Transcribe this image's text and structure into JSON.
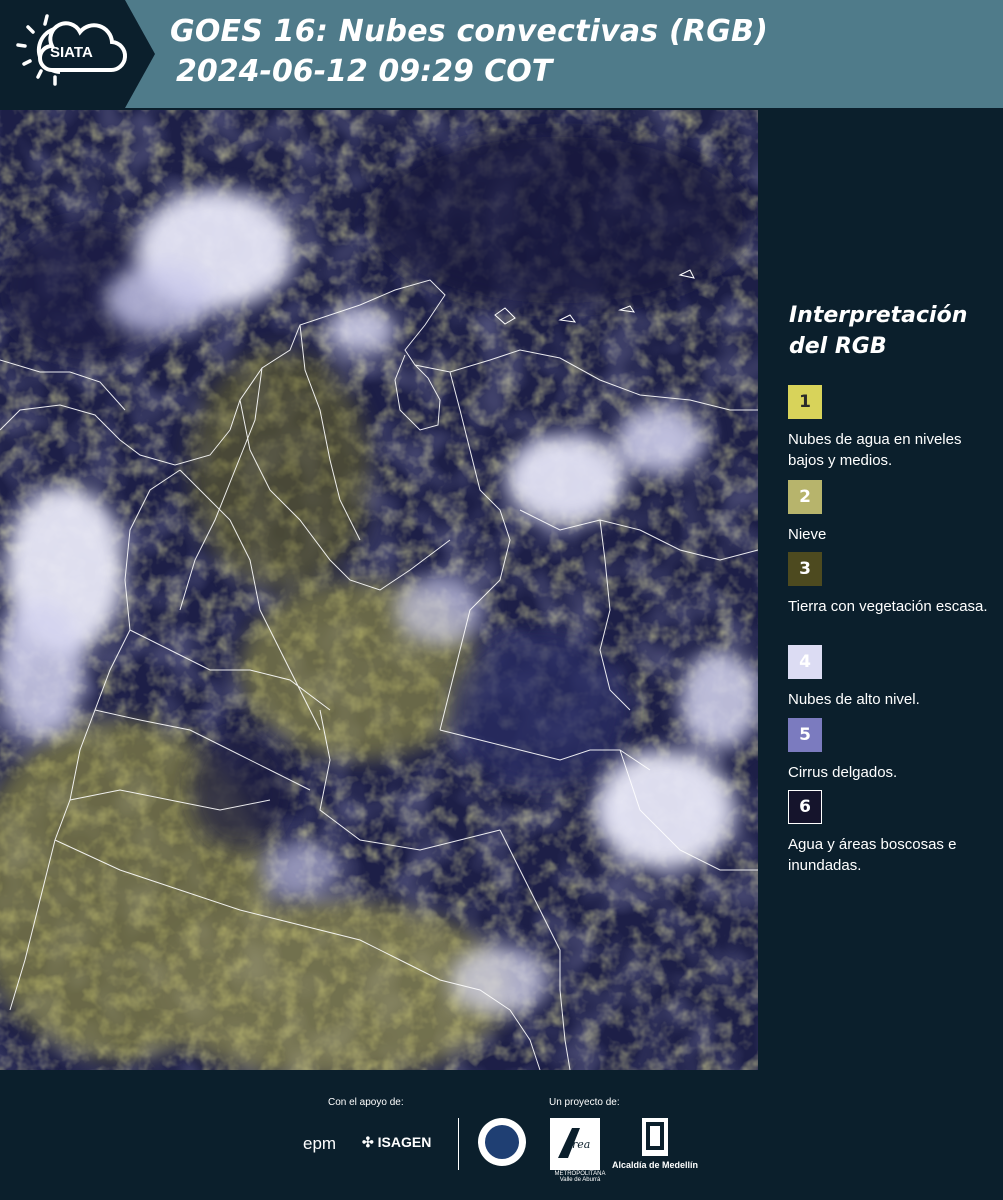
{
  "header": {
    "logo_text": "SIATA",
    "title_line1": "GOES 16: Nubes convectivas (RGB)",
    "title_line2": "2024-06-12 09:29 COT"
  },
  "legend": {
    "title_line1": "Interpretación",
    "title_line2": "del RGB",
    "items": [
      {
        "number": "1",
        "label": "Nubes de agua en niveles bajos y medios.",
        "color": "#d8d35a",
        "text_color": "#2a2a2a"
      },
      {
        "number": "2",
        "label": "Nieve",
        "color": "#b7b46c",
        "text_color": "#ffffff"
      },
      {
        "number": "3",
        "label": "Tierra con vegetación escasa.",
        "color": "#4d4a1f",
        "text_color": "#ffffff"
      },
      {
        "number": "4",
        "label": "Nubes de alto nivel.",
        "color": "#dcdcf3",
        "text_color": "#ffffff"
      },
      {
        "number": "5",
        "label": "Cirrus delgados.",
        "color": "#7b7bbf",
        "text_color": "#ffffff"
      },
      {
        "number": "6",
        "label": "Agua y áreas boscosas e inundadas.",
        "color": "#15142c",
        "text_color": "#ffffff"
      }
    ]
  },
  "footer": {
    "support_caption": "Con el apoyo de:",
    "project_caption": "Un proyecto de:",
    "sponsor1": "epm",
    "sponsor2": "ISAGEN",
    "amva": "METROPOLITANA Valle de Aburrá",
    "alcaldia": "Alcaldía de Medellín"
  },
  "colors": {
    "header_bg": "#4f7b8a",
    "panel_bg": "#0b1f2c",
    "cloud_high": "#dcdcf3",
    "cloud_low": "#d8d35a",
    "water": "#1c1f45"
  }
}
